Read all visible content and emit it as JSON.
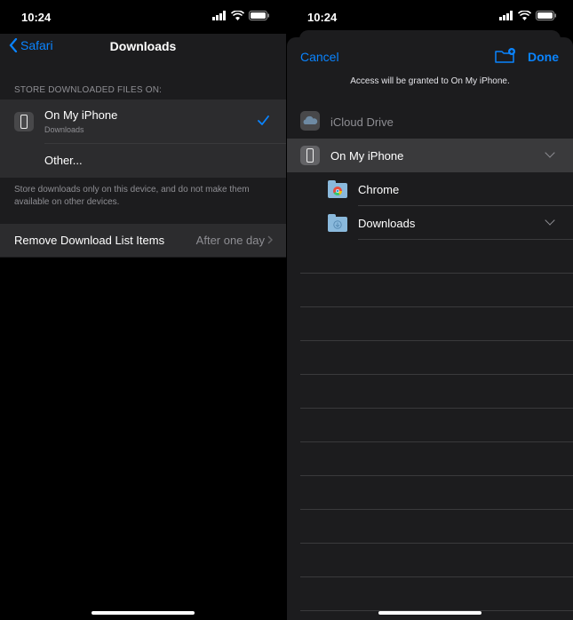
{
  "left": {
    "status_time": "10:24",
    "back_label": "Safari",
    "title": "Downloads",
    "section_header": "STORE DOWNLOADED FILES ON:",
    "location_name": "On My iPhone",
    "location_sub": "Downloads",
    "other_label": "Other...",
    "footer_note": "Store downloads only on this device, and do not make them available on other devices.",
    "remove_label": "Remove Download List Items",
    "remove_value": "After one day"
  },
  "right": {
    "status_time": "10:24",
    "cancel_label": "Cancel",
    "done_label": "Done",
    "access_note": "Access will be granted to On My iPhone.",
    "icloud_label": "iCloud Drive",
    "iphone_label": "On My iPhone",
    "folders": [
      "Chrome",
      "Downloads"
    ]
  },
  "colors": {
    "accent": "#0a84ff",
    "background": "#000000",
    "cell": "#2c2c2e"
  }
}
